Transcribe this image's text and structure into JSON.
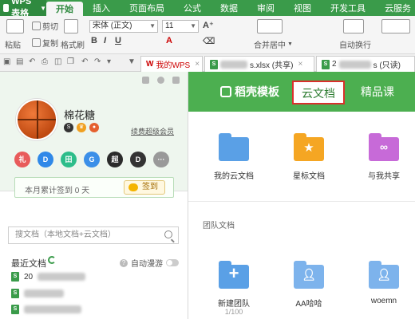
{
  "app": {
    "menu_label": "WPS 表格"
  },
  "tabs": [
    "开始",
    "插入",
    "页面布局",
    "公式",
    "数据",
    "审阅",
    "视图",
    "开发工具",
    "云服务"
  ],
  "ribbon": {
    "paste": "粘贴",
    "cut": "剪切",
    "copy": "复制",
    "format_painter": "格式刷",
    "font_name": "宋体 (正文)",
    "font_size": "11",
    "merge_center": "合并居中",
    "auto_wrap": "自动换行"
  },
  "doc_tabs": [
    {
      "label": "我的WPS"
    },
    {
      "label": "s.xlsx (共享)"
    },
    {
      "label": "2",
      "suffix": "s (只读)"
    }
  ],
  "profile": {
    "username": "棉花糖",
    "vip_link": "续费超级会员",
    "checkin_text": "本月累计签到 0 天",
    "checkin_button": "签到"
  },
  "service_icons": [
    {
      "name": "gift",
      "glyph": "礼",
      "color": "#e85b5b"
    },
    {
      "name": "docer",
      "glyph": "D",
      "color": "#2f88e8"
    },
    {
      "name": "table",
      "glyph": "田",
      "color": "#2dbd8a"
    },
    {
      "name": "g-app",
      "glyph": "G",
      "color": "#3b8fe8"
    },
    {
      "name": "super",
      "glyph": "超",
      "color": "#2b2b2b"
    },
    {
      "name": "d-app",
      "glyph": "D",
      "color": "#333"
    },
    {
      "name": "more",
      "glyph": "···",
      "color": "#999"
    }
  ],
  "search": {
    "placeholder": "搜文档（本地文档+云文档）"
  },
  "recent": {
    "title": "最近文档",
    "auto_roam": "自动漫游",
    "items": [
      "20",
      "",
      ""
    ]
  },
  "cloud_tabs": {
    "docer_templates": "稻壳模板",
    "cloud_docs": "云文档",
    "courses": "精品课"
  },
  "cloud_folders": [
    {
      "label": "我的云文档",
      "color": "#5aa0e6"
    },
    {
      "label": "星标文档",
      "color": "#f5a623"
    },
    {
      "label": "与我共享",
      "color": "#c76ad8"
    }
  ],
  "team": {
    "section_label": "团队文档",
    "items": [
      {
        "label": "新建团队",
        "sub": "1/100"
      },
      {
        "label": "AA哈哈",
        "sub": ""
      },
      {
        "label": "woemn",
        "sub": ""
      }
    ]
  }
}
